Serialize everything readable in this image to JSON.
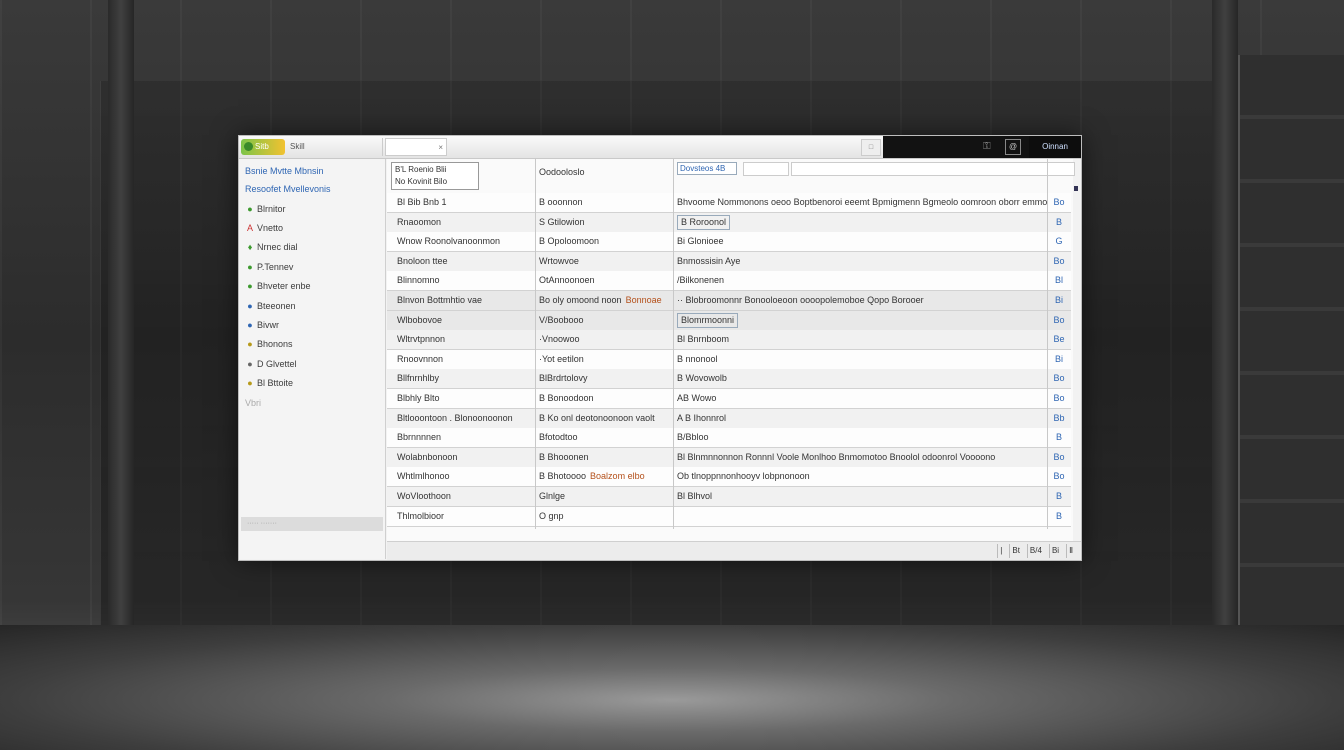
{
  "titlebar": {
    "app_label": "Sitb",
    "tab_title": "Skill",
    "tab_field": "×",
    "box_icon": "□",
    "icon_a": "⚿",
    "icon_b": "@",
    "user_label": "Oinnan"
  },
  "sidebar": {
    "items": [
      {
        "label": "Bsnie Mvtte Mbnsin",
        "icon": "",
        "style": "link"
      },
      {
        "label": "Resoofet Mvellevonis",
        "icon": "",
        "style": "link"
      },
      {
        "label": "Blrnitor",
        "icon": "●",
        "icon_color": "g"
      },
      {
        "label": "Vnetto",
        "icon": "A",
        "icon_color": "r"
      },
      {
        "label": "Nrnec dial",
        "icon": "♦",
        "icon_color": "g"
      },
      {
        "label": "P.Tennev",
        "icon": "●",
        "icon_color": "g"
      },
      {
        "label": "Bhveter enbe",
        "icon": "●",
        "icon_color": "g"
      },
      {
        "label": "Bteeonen",
        "icon": "●",
        "icon_color": "b"
      },
      {
        "label": "Bivwr",
        "icon": "●",
        "icon_color": "b"
      },
      {
        "label": "Bhonons",
        "icon": "●",
        "icon_color": "y"
      },
      {
        "label": "D Glvettel",
        "icon": "●",
        "icon_color": "gr"
      },
      {
        "label": "Bl Bttoite",
        "icon": "●",
        "icon_color": "y"
      },
      {
        "label": "Vbri",
        "icon": "",
        "style": "muted"
      }
    ],
    "footer": "····· ·······"
  },
  "table": {
    "header": {
      "box_line1": "B'L Roenio Blii",
      "box_line2": "No Kovinit Bilo",
      "col2": "Oodooloslo",
      "col3_badge": "Dovsteos 4B",
      "col4": "▾"
    },
    "rows": [
      {
        "c1": "Bl Bib Bnb 1",
        "c2": "B ooonnon",
        "c3": "Bhvoome Nommonons oeoo Boptbenoroi eeemt Bpmigmenn Bgmeolo oomroon oborr emmooron",
        "c4": "Bo"
      },
      {
        "c1": "Rnaoomon",
        "c2": "S Gtilowion",
        "c3": "B Roroonol",
        "c3_badge": true,
        "c4": "B"
      },
      {
        "c1": "Wnow Roonolvanoonmon",
        "c2": "B Opoloomoon",
        "c3": "Bi Glonioee",
        "c4": "G"
      },
      {
        "c1": "Bnoloon ttee",
        "c2": "Wrtowvoe",
        "c3": "Bnmossisin Aye",
        "c4": "Bo"
      },
      {
        "c1": "Blinnomno",
        "c2": "OtAnnoonoen",
        "c3": "/Bilkonenen",
        "c4": "Bl"
      },
      {
        "c1": "Blnvon Bottmhtio vae",
        "c2": "Bo oly omoond noon",
        "c2_accent": "Bonnoae",
        "c3": "·· Blobroomonnr Bonooloeoon oooopolemoboe Qopo Borooer",
        "c4": "Bi"
      },
      {
        "c1": "Wlbobovoe",
        "c2": "V/Boobooo",
        "c3": "Blomrmoonni",
        "c3_badge": true,
        "c4": "Bo"
      },
      {
        "c1": "Wltrvtpnnon",
        "c2": "·Vnoowoo",
        "c3": "Bl Bnrnboom",
        "c4": "Be"
      },
      {
        "c1": "Rnoovnnon",
        "c2": "·Yot eetilon",
        "c3": "B nnonool",
        "c4": "Bi"
      },
      {
        "c1": "Bllfnrnhlby",
        "c2": "BlBrdrtolovy",
        "c3": "B Wovowolb",
        "c4": "Bo"
      },
      {
        "c1": "Blbhly Blto",
        "c2": "B Bonoodoon",
        "c3": "AB Wowo",
        "c4": "Bo"
      },
      {
        "c1": "Bltlooontoon . Blonoonoonon",
        "c2": "B Ko onl deotonoonoon vaolt",
        "c3": "A B Ihonnrol",
        "c4": "Bb"
      },
      {
        "c1": "Bbrnnnnen",
        "c2": "Bfotodtoo",
        "c3": "B/Bbloo",
        "c4": "B"
      },
      {
        "c1": "Wolabnbonoon",
        "c2": "B Bhooonen",
        "c3": "Bl Blnmnnonnon Ronnnl Voole Monlhoo Bnmomotoo Bnoolol odoonrol Voooono",
        "c4": "Bo"
      },
      {
        "c1": "Whtlmlhonoo",
        "c2": "B Bhotoooo",
        "c2_accent": "Boalzom elbo",
        "c3": "Ob tlnoppnnonhooyv lobpnonoon",
        "c4": "Bo"
      },
      {
        "c1": "WoVloothoon",
        "c2": "Glnlge",
        "c3": "Bl Blhvol",
        "c4": "B"
      },
      {
        "c1": "Thlmolbioor",
        "c2": "O gnp",
        "c3": "",
        "c4": "B"
      }
    ]
  },
  "statusbar": {
    "pager": [
      "|",
      "Bt",
      "B/4",
      "Bi",
      "Ⅱ"
    ]
  }
}
